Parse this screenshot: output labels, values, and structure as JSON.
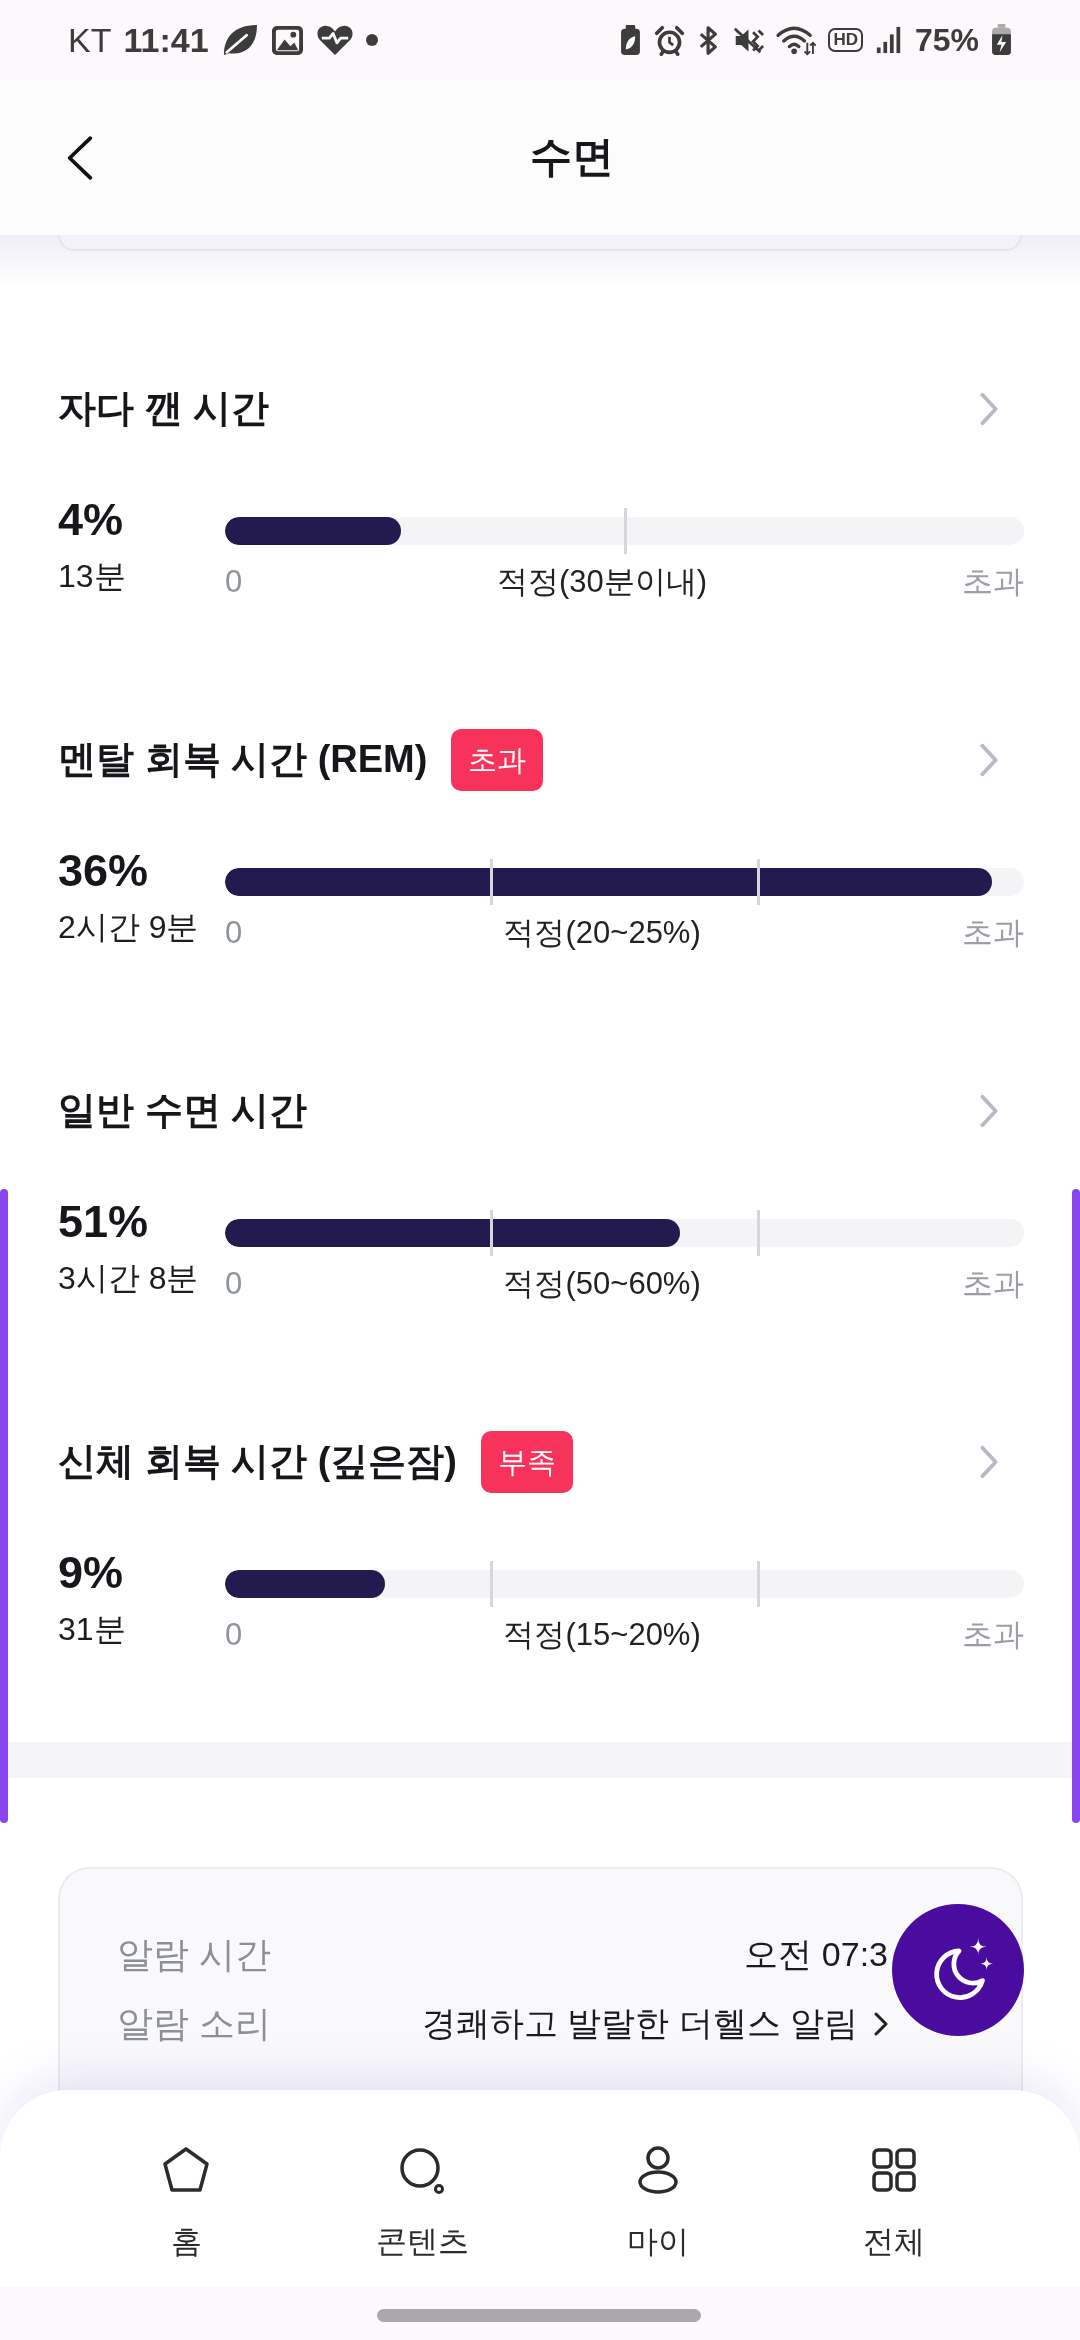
{
  "status_bar": {
    "carrier": "KT",
    "time": "11:41",
    "hd_label": "HD",
    "battery": "75%"
  },
  "header": {
    "title": "수면"
  },
  "sections": [
    {
      "title": "자다 깬 시간",
      "kind": "limit",
      "percent": "4%",
      "duration": "13분",
      "level": 0.22,
      "scale": {
        "min": "0",
        "optimal": "적정(30분이내)",
        "over": "초과"
      }
    },
    {
      "title": "멘탈 회복 시간 (REM)",
      "badge": "초과",
      "kind": "range",
      "percent": "36%",
      "duration": "2시간 9분",
      "level": 0.96,
      "scale": {
        "min": "0",
        "optimal": "적정(20~25%)",
        "over": "초과"
      }
    },
    {
      "title": "일반 수면 시간",
      "kind": "range",
      "percent": "51%",
      "duration": "3시간 8분",
      "level": 0.57,
      "scale": {
        "min": "0",
        "optimal": "적정(50~60%)",
        "over": "초과"
      }
    },
    {
      "title": "신체 회복 시간 (깊은잠)",
      "badge": "부족",
      "kind": "range",
      "percent": "9%",
      "duration": "31분",
      "level": 0.2,
      "scale": {
        "min": "0",
        "optimal": "적정(15~20%)",
        "over": "초과"
      }
    }
  ],
  "alarm": {
    "rows": [
      {
        "label": "알람 시간",
        "value": "오전 07:3",
        "kind": "plain"
      },
      {
        "label": "알람 소리",
        "value": "경쾌하고 발랄한 더헬스 알림",
        "kind": "link"
      }
    ]
  },
  "nav": [
    {
      "label": "홈",
      "selected": false
    },
    {
      "label": "콘텐츠",
      "selected": false
    },
    {
      "label": "마이",
      "selected": false
    },
    {
      "label": "전체",
      "selected": false
    }
  ]
}
